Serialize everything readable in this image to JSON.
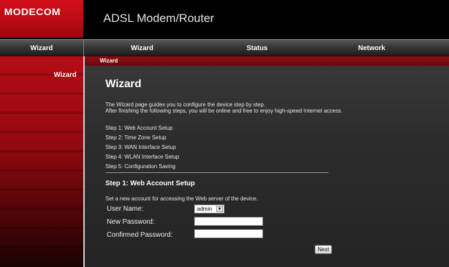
{
  "header": {
    "logo_text": "MODECOM",
    "app_title": "ADSL Modem/Router"
  },
  "nav": {
    "left_label": "Wizard",
    "items": [
      "Wizard",
      "Status",
      "Network"
    ]
  },
  "sidebar": {
    "items": [
      "Wizard"
    ]
  },
  "main": {
    "breadcrumb": "Wizard",
    "title": "Wizard",
    "intro_line1": "The Wizard page guides you to configure the device step by step.",
    "intro_line2": "After finishing the following steps, you will be online and free to enjoy high-speed Internet access.",
    "steps": [
      "Step 1: Web Account Setup",
      "Step 2: Time Zone Setup",
      "Step 3: WAN Interface Setup",
      "Step 4: WLAN Interface Setup",
      "Step 5: Configuration Saving"
    ],
    "section_title": "Step 1: Web Account Setup",
    "section_desc": "Set a new account for accessing the Web server of the device.",
    "form": {
      "user_name_label": "User Name:",
      "user_name_value": "admin",
      "new_password_label": "New Password:",
      "new_password_value": "",
      "confirm_password_label": "Confirmed Password:",
      "confirm_password_value": ""
    },
    "next_label": "Next"
  },
  "colors": {
    "brand_red": "#c8101a",
    "background": "#2c2c2c"
  }
}
